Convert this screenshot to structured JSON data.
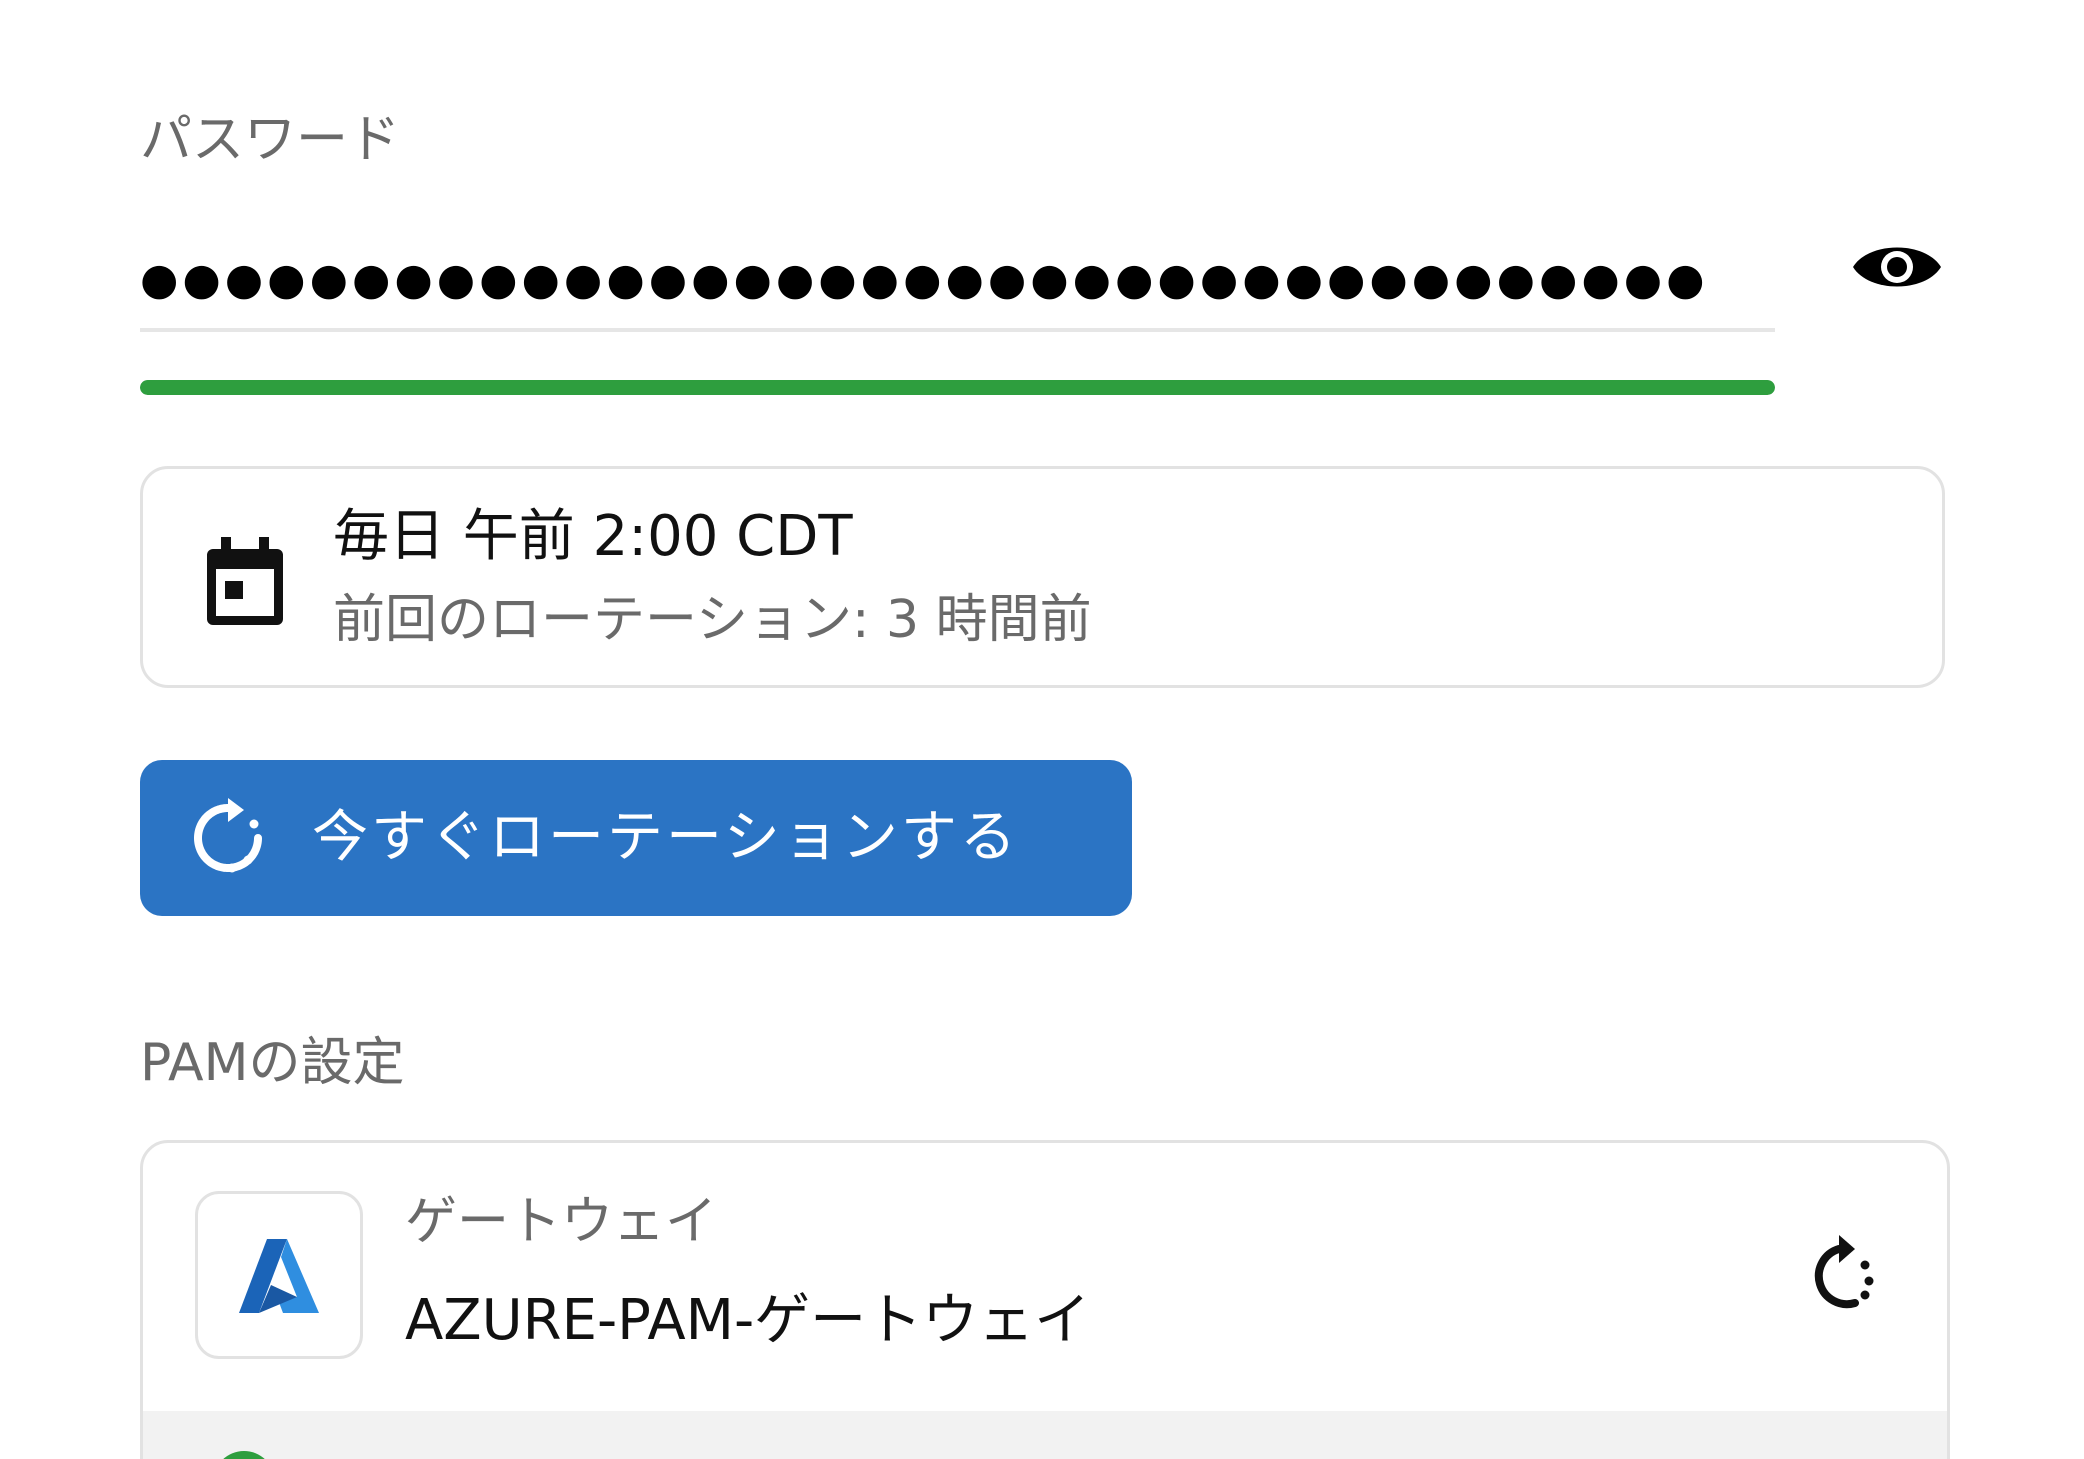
{
  "password": {
    "label": "パスワード",
    "masked_value": "●●●●●●●●●●●●●●●●●●●●●●●●●●●●●●●●●●●●●●●●●●●●",
    "strength_fraction": 1.0,
    "strength_color": "#2e9e3e",
    "toggle_icon": "eye-icon"
  },
  "schedule": {
    "icon": "calendar-icon",
    "frequency": "毎日 午前 2:00 CDT",
    "last_rotation": "前回のローテーション: 3 時間前"
  },
  "rotate_button": {
    "label": "今すぐローテーションする",
    "icon": "rotate-icon",
    "background": "#2b74c4"
  },
  "pam_settings": {
    "section_label": "PAMの設定",
    "gateway": {
      "type_label": "ゲートウェイ",
      "name": "AZURE-PAM-ゲートウェイ",
      "logo": "azure-logo",
      "action_icon": "rotate-icon"
    },
    "next_row_status_color": "#2e9e3e"
  }
}
